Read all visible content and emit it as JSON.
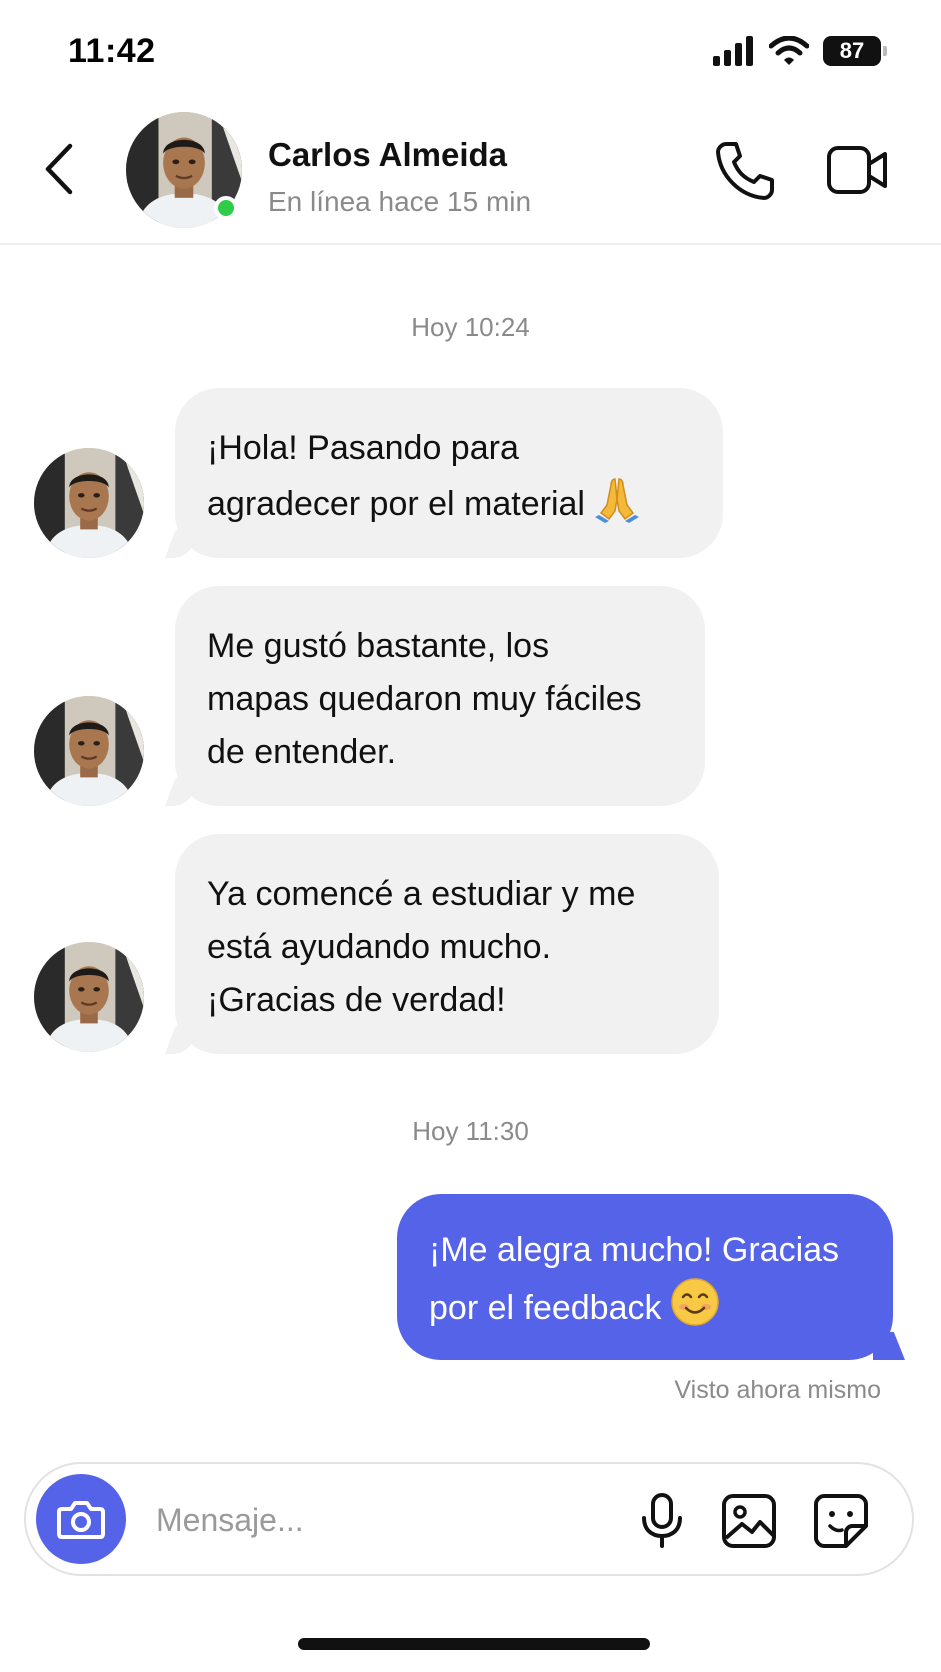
{
  "status_bar": {
    "time": "11:42",
    "battery": "87"
  },
  "header": {
    "contact_name": "Carlos Almeida",
    "contact_status": "En línea hace 15 min",
    "icons": [
      "back-icon",
      "phone-icon",
      "video-camera-icon"
    ]
  },
  "chat": {
    "separators": [
      "Hoy 10:24",
      "Hoy 11:30"
    ],
    "incoming": [
      {
        "lines": [
          "¡Hola! Pasando para",
          "agradecer por el material"
        ],
        "emoji": "🙏"
      },
      {
        "lines": [
          "Me gustó bastante, los",
          "mapas quedaron muy fáciles",
          "de entender."
        ]
      },
      {
        "lines": [
          "Ya comencé a estudiar y me",
          "está ayudando mucho.",
          "¡Gracias de verdad!"
        ]
      }
    ],
    "outgoing": [
      {
        "lines": [
          "¡Me alegra mucho! Gracias",
          "por el feedback"
        ],
        "emoji": "😊"
      }
    ],
    "seen_status": "Visto ahora mismo"
  },
  "composer": {
    "placeholder": "Mensaje...",
    "icons": [
      "camera-icon",
      "microphone-icon",
      "gallery-icon",
      "sticker-icon"
    ]
  },
  "colors": {
    "accent": "#5563e8",
    "incoming_bubble": "#f1f1f1",
    "online": "#2ecc48"
  }
}
